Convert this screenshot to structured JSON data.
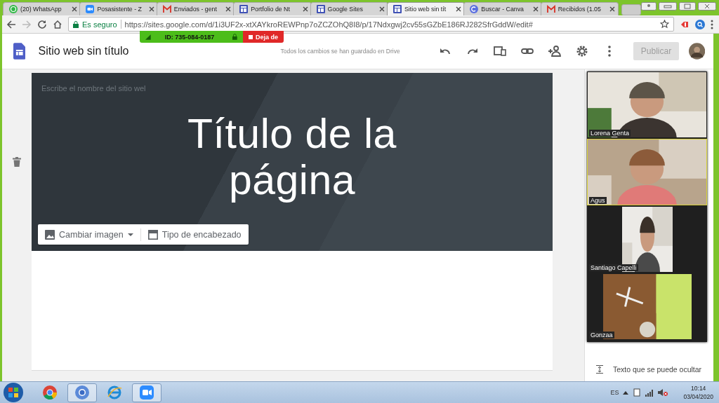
{
  "tabs": [
    {
      "label": "(20) WhatsApp",
      "selected": false
    },
    {
      "label": "Posasistente - Z",
      "selected": false
    },
    {
      "label": "Enviados - gent",
      "selected": false
    },
    {
      "label": "Portfolio de Nt",
      "selected": false
    },
    {
      "label": "Google Sites",
      "selected": false
    },
    {
      "label": "Sitio web sin tít",
      "selected": true
    },
    {
      "label": "Buscar - Canva",
      "selected": false
    },
    {
      "label": "Recibidos (1.05",
      "selected": false
    }
  ],
  "address_bar": {
    "security": "Es seguro",
    "url": "https://sites.google.com/d/1i3UF2x-xtXAYkroREWPnp7oZCZOhQ8I8/p/17Ndxgwj2cv55sGZbE186RJ282SfrGddW/edit#"
  },
  "meeting_bar": {
    "meeting_id": "ID: 735-084-0187",
    "stop": "Deja de"
  },
  "sites_toolbar": {
    "title": "Sitio web sin título",
    "status": "Todos los cambios se han guardado en Drive",
    "publish": {
      "label": "Publicar",
      "disabled": true
    }
  },
  "header": {
    "site_name_placeholder": "Escribe el nombre del sitio wel",
    "page_title": "Título de la página",
    "actions": [
      "Cambiar imagen",
      "Tipo de encabezado"
    ]
  },
  "side_panel": {
    "item": "Texto que se puede ocultar"
  },
  "participants": [
    {
      "name": "Lorena Genta",
      "active": false
    },
    {
      "name": "Agus",
      "active": true
    },
    {
      "name": "Santiago Capelli",
      "active": false
    },
    {
      "name": "Gonzaa",
      "active": false
    }
  ],
  "taskbar": {
    "language": "ES",
    "time": "10:14",
    "date": "03/04/2020"
  }
}
